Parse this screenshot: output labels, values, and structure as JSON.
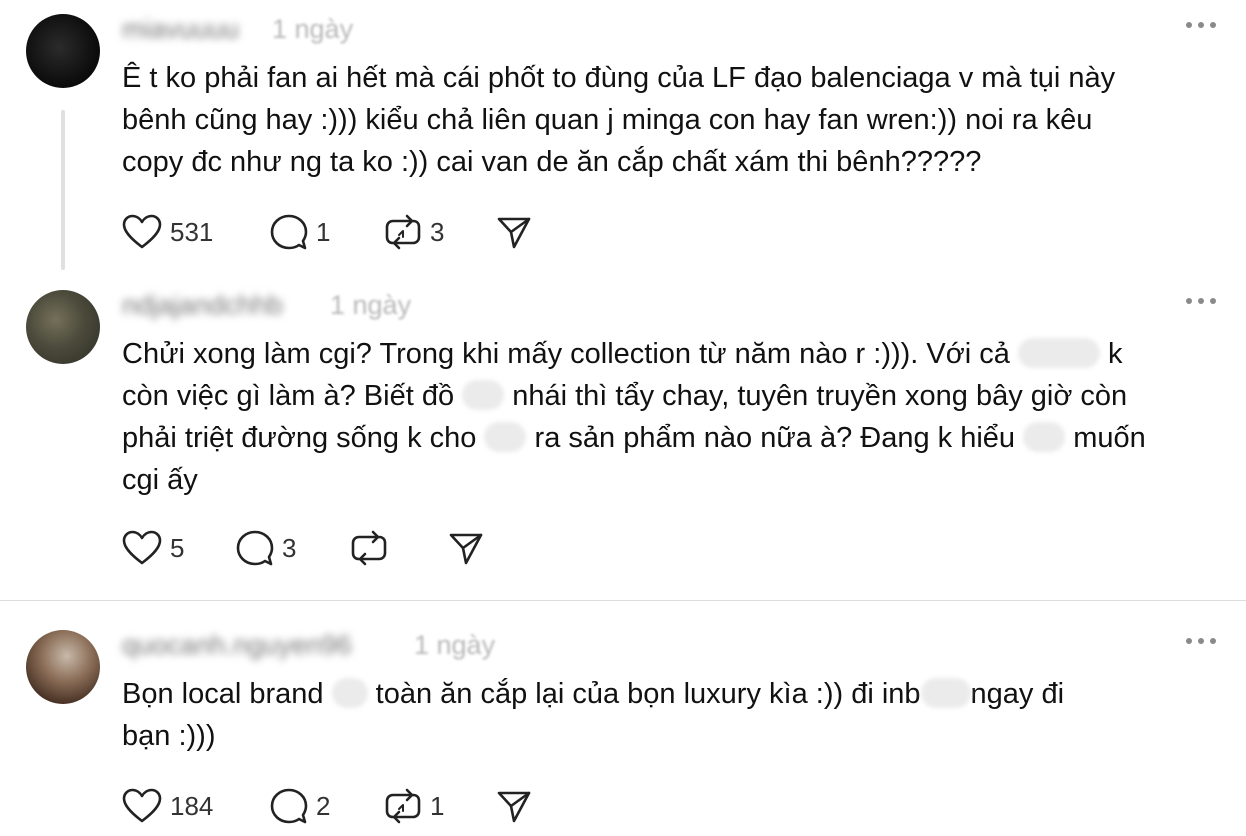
{
  "comments": [
    {
      "username": "miavuuuu",
      "time": "1 ngày",
      "lines": [
        "Ê t ko phải fan ai hết mà cái phốt to đùng của LF đạo balenciaga v mà tụi này",
        "bênh cũng hay :))) kiểu chả liên quan j minga con hay fan wren:)) noi ra kêu",
        "copy đc như ng ta ko :)) cai van de ăn cắp chất xám thi bênh?????"
      ],
      "likes": "531",
      "replies": "1",
      "reposts": "3"
    },
    {
      "username": "ndjajandchhb",
      "time": "1 ngày",
      "line1_a": "Chửi xong làm cgi? Trong khi mấy collection từ năm nào r :))). Với cả",
      "line1_b": "k",
      "line2_a": "còn việc gì làm à? Biết đồ",
      "line2_b": "nhái thì tẩy chay, tuyên truyền xong bây giờ còn",
      "line3_a": "phải triệt đường sống k cho",
      "line3_b": "ra sản phẩm nào nữa à? Đang k hiểu",
      "line3_c": "muốn",
      "line4": "cgi ấy",
      "likes": "5",
      "replies": "3",
      "reposts": ""
    },
    {
      "username": "quocanh.nguyen96",
      "time": "1 ngày",
      "line1_a": "Bọn local brand",
      "line1_b": "toàn ăn cắp lại của bọn luxury kìa :)) đi inb",
      "line1_c": "ngay đi",
      "line2": "bạn :)))",
      "likes": "184",
      "replies": "2",
      "reposts": "1"
    }
  ],
  "icons": {
    "like": "heart-icon",
    "reply": "comment-icon",
    "repost": "repost-icon",
    "share": "send-icon",
    "more": "more-horizontal-icon"
  }
}
